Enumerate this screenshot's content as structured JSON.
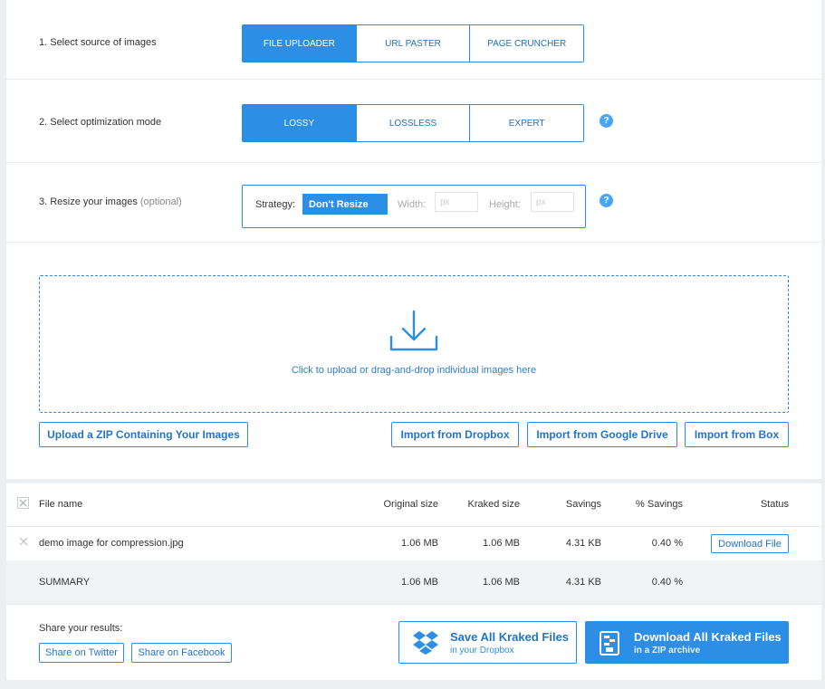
{
  "step1": {
    "label": "1. Select source of images",
    "options": [
      "FILE UPLOADER",
      "URL PASTER",
      "PAGE CRUNCHER"
    ],
    "selected": "FILE UPLOADER"
  },
  "step2": {
    "label": "2. Select optimization mode",
    "options": [
      "LOSSY",
      "LOSSLESS",
      "EXPERT"
    ],
    "selected": "LOSSY"
  },
  "step3": {
    "label": "3. Resize your images",
    "label_optional": "(optional)",
    "strategy_label": "Strategy:",
    "strategy_value": "Don't Resize",
    "width_label": "Width:",
    "width_placeholder": "px",
    "height_label": "Height:",
    "height_placeholder": "px"
  },
  "help_glyph": "?",
  "upload": {
    "dropzone_text": "Click to upload or drag-and-drop individual images here",
    "zip_button": "Upload a ZIP Containing Your Images",
    "dropbox_button": "Import from Dropbox",
    "gdrive_button": "Import from Google Drive",
    "box_button": "Import from Box"
  },
  "table": {
    "headers": [
      "File name",
      "Original size",
      "Kraked size",
      "Savings",
      "% Savings",
      "Status"
    ],
    "rows": [
      {
        "file": "demo image for compression.jpg",
        "original": "1.06 MB",
        "kraked": "1.06 MB",
        "savings": "4.31 KB",
        "pct": "0.40 %",
        "status_button": "Download File"
      }
    ],
    "summary": {
      "label": "SUMMARY",
      "original": "1.06 MB",
      "kraked": "1.06 MB",
      "savings": "4.31 KB",
      "pct": "0.40 %"
    }
  },
  "share": {
    "label": "Share your results:",
    "twitter": "Share on Twitter",
    "facebook": "Share on Facebook"
  },
  "save_dropbox": {
    "title": "Save All Kraked Files",
    "subtitle": "in your Dropbox"
  },
  "download_zip": {
    "title": "Download All Kraked Files",
    "subtitle": "in a ZIP archive"
  },
  "colors": {
    "accent": "#2d8ee6",
    "accent_dark": "#1f6fbf",
    "help": "#4aa6ef"
  }
}
